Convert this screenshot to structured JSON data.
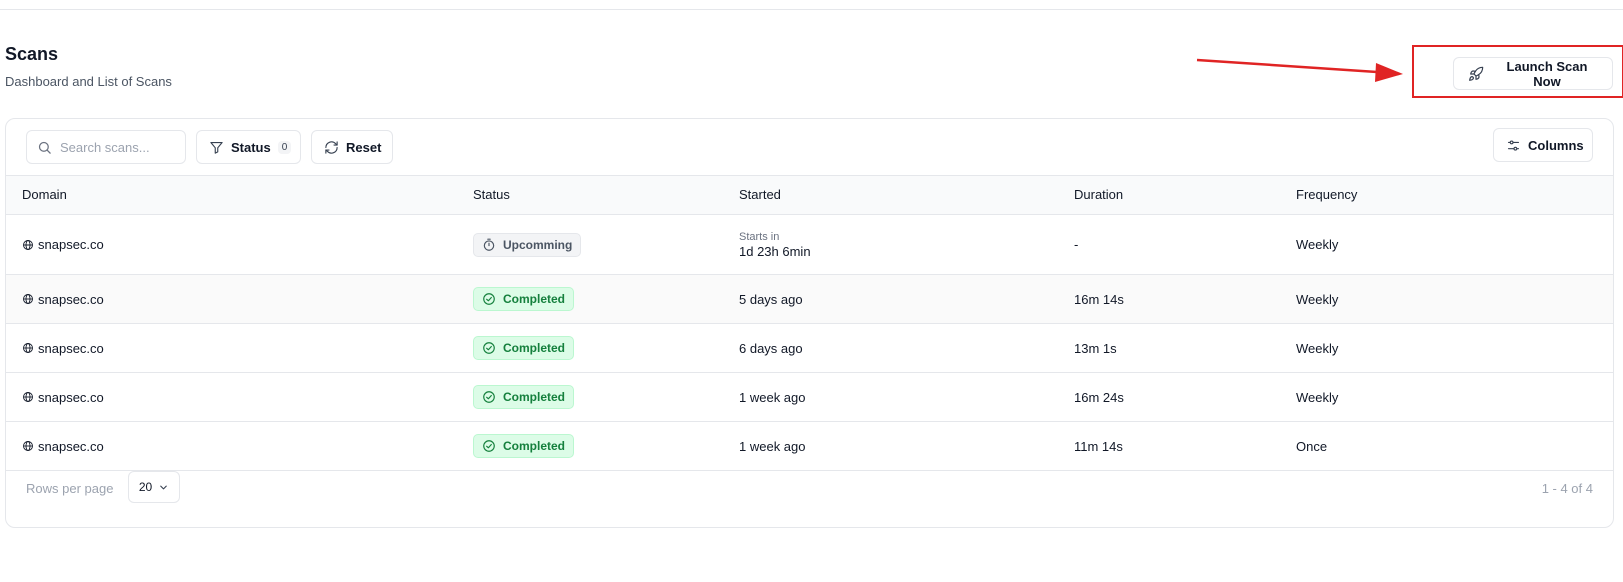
{
  "header": {
    "title": "Scans",
    "subtitle": "Dashboard and List of Scans",
    "launch_label": "Launch Scan Now"
  },
  "annotation": {
    "color": "#e02424"
  },
  "toolbar": {
    "search_placeholder": "Search scans...",
    "status_label": "Status",
    "status_count": "0",
    "reset_label": "Reset",
    "columns_label": "Columns"
  },
  "table": {
    "columns": [
      "Domain",
      "Status",
      "Started",
      "Duration",
      "Frequency"
    ],
    "rows": [
      {
        "domain": "snapsec.co",
        "status": "Upcomming",
        "started_prefix": "Starts in",
        "started": "1d 23h 6min",
        "duration": "-",
        "frequency": "Weekly"
      },
      {
        "domain": "snapsec.co",
        "status": "Completed",
        "started": "5 days ago",
        "duration": "16m 14s",
        "frequency": "Weekly"
      },
      {
        "domain": "snapsec.co",
        "status": "Completed",
        "started": "6 days ago",
        "duration": "13m 1s",
        "frequency": "Weekly"
      },
      {
        "domain": "snapsec.co",
        "status": "Completed",
        "started": "1 week ago",
        "duration": "16m 24s",
        "frequency": "Weekly"
      },
      {
        "domain": "snapsec.co",
        "status": "Completed",
        "started": "1 week ago",
        "duration": "11m 14s",
        "frequency": "Once"
      }
    ]
  },
  "footer": {
    "rows_per_page_label": "Rows per page",
    "rows_per_page_value": "20",
    "pagination": "1 - 4 of 4"
  },
  "colors": {
    "completed_bg": "#dcfce7",
    "completed_text": "#15803d",
    "upcoming_bg": "#f3f4f6",
    "border": "#e5e7eb"
  }
}
